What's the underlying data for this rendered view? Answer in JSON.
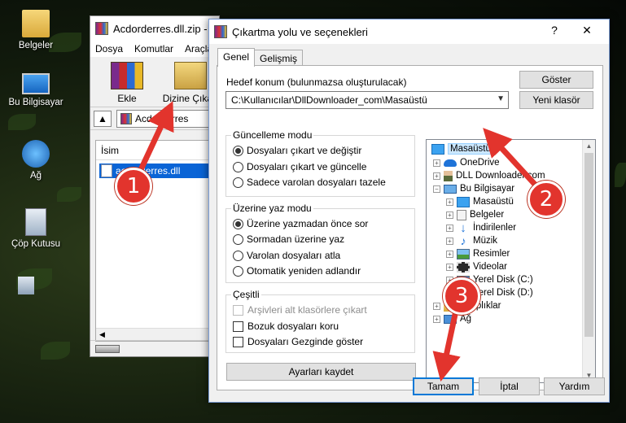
{
  "desktop": {
    "icons": [
      {
        "label": "Belgeler"
      },
      {
        "label": "Bu Bilgisayar"
      },
      {
        "label": "Ağ"
      },
      {
        "label": "Çöp Kutusu"
      }
    ]
  },
  "rar_window": {
    "title": "Acdorderres.dll.zip -",
    "menu": [
      "Dosya",
      "Komutlar",
      "Araçlar"
    ],
    "toolbar": {
      "add_label": "Ekle",
      "extract_label": "Dizine Çıkart"
    },
    "address": "Acdorderres",
    "column_name": "İsim",
    "file": "acdorderres.dll"
  },
  "dialog": {
    "title": "Çıkartma yolu ve seçenekleri",
    "tabs": [
      "Genel",
      "Gelişmiş"
    ],
    "dest_label": "Hedef konum (bulunmazsa oluşturulacak)",
    "dest_value": "C:\\Kullanıcılar\\DllDownloader_com\\Masaüstü",
    "show_button": "Göster",
    "new_folder_button": "Yeni klasör",
    "update_mode": {
      "title": "Güncelleme modu",
      "options": [
        {
          "label": "Dosyaları çıkart ve değiştir",
          "selected": true
        },
        {
          "label": "Dosyaları çıkart ve güncelle",
          "selected": false
        },
        {
          "label": "Sadece varolan dosyaları tazele",
          "selected": false
        }
      ]
    },
    "overwrite_mode": {
      "title": "Üzerine yaz modu",
      "options": [
        {
          "label": "Üzerine yazmadan önce sor",
          "selected": true
        },
        {
          "label": "Sormadan üzerine yaz",
          "selected": false
        },
        {
          "label": "Varolan dosyaları atla",
          "selected": false
        },
        {
          "label": "Otomatik yeniden adlandır",
          "selected": false
        }
      ]
    },
    "misc": {
      "title": "Çeşitli",
      "options": [
        {
          "label": "Arşivleri alt klasörlere çıkart",
          "checked": false,
          "disabled": true
        },
        {
          "label": "Bozuk dosyaları koru",
          "checked": false,
          "disabled": false
        },
        {
          "label": "Dosyaları Gezginde göster",
          "checked": false,
          "disabled": false
        }
      ]
    },
    "save_settings_button": "Ayarları kaydet",
    "tree": [
      {
        "label": "Masaüstü",
        "level": 0,
        "selected": true
      },
      {
        "label": "OneDrive",
        "level": 1
      },
      {
        "label": "DLL Downloader.com",
        "level": 1
      },
      {
        "label": "Bu Bilgisayar",
        "level": 1
      },
      {
        "label": "Masaüstü",
        "level": 2
      },
      {
        "label": "Belgeler",
        "level": 2
      },
      {
        "label": "İndirilenler",
        "level": 2
      },
      {
        "label": "Müzik",
        "level": 2
      },
      {
        "label": "Resimler",
        "level": 2
      },
      {
        "label": "Videolar",
        "level": 2
      },
      {
        "label": "Yerel Disk (C:)",
        "level": 2
      },
      {
        "label": "Yerel Disk (D:)",
        "level": 2
      },
      {
        "label": "Kitaplıklar",
        "level": 1
      },
      {
        "label": "Ağ",
        "level": 1
      }
    ],
    "ok_button": "Tamam",
    "cancel_button": "İptal",
    "help_button": "Yardım"
  },
  "annotations": [
    "1",
    "2",
    "3"
  ],
  "colors": {
    "badge": "#e2342d",
    "selection": "#0a64d6",
    "primary_border": "#0078d7"
  }
}
